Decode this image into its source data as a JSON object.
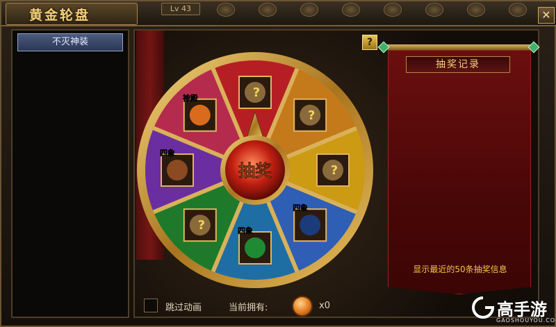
{
  "window": {
    "title": "黄金轮盘",
    "level": "Lv 43",
    "close_symbol": "✕"
  },
  "left_panel": {
    "tab_label": "不灭神装"
  },
  "wheel": {
    "center_label": "抽奖",
    "segment_colors": [
      "#b51f24",
      "#c8421d",
      "#c4791a",
      "#cc9a13",
      "#1e7a2a",
      "#1f6ea3",
      "#2f5fb5",
      "#6a2ea0",
      "#a6297f",
      "#b52b4d"
    ],
    "items": [
      {
        "tag": "",
        "icon": "mystery-armor-icon"
      },
      {
        "tag": "",
        "icon": "mystery-armor-icon"
      },
      {
        "tag": "",
        "icon": "mystery-armor-icon"
      },
      {
        "tag": "四象",
        "icon": "yin-yang-orb-icon"
      },
      {
        "tag": "四象",
        "icon": "green-gem-icon"
      },
      {
        "tag": "",
        "icon": "mystery-armor-icon"
      },
      {
        "tag": "四象",
        "icon": "bronze-shield-icon"
      },
      {
        "tag": "神殿",
        "icon": "fire-crystal-icon"
      }
    ]
  },
  "help": {
    "label": "?"
  },
  "record": {
    "title": "抽奖记录",
    "hint": "显示最近的50条抽奖信息"
  },
  "bottom": {
    "skip_label": "跳过动画",
    "own_label": "当前拥有:",
    "coin_count": "x0"
  },
  "watermark": {
    "text": "高手游",
    "sub": "GAOSHOUYOU.COM"
  }
}
